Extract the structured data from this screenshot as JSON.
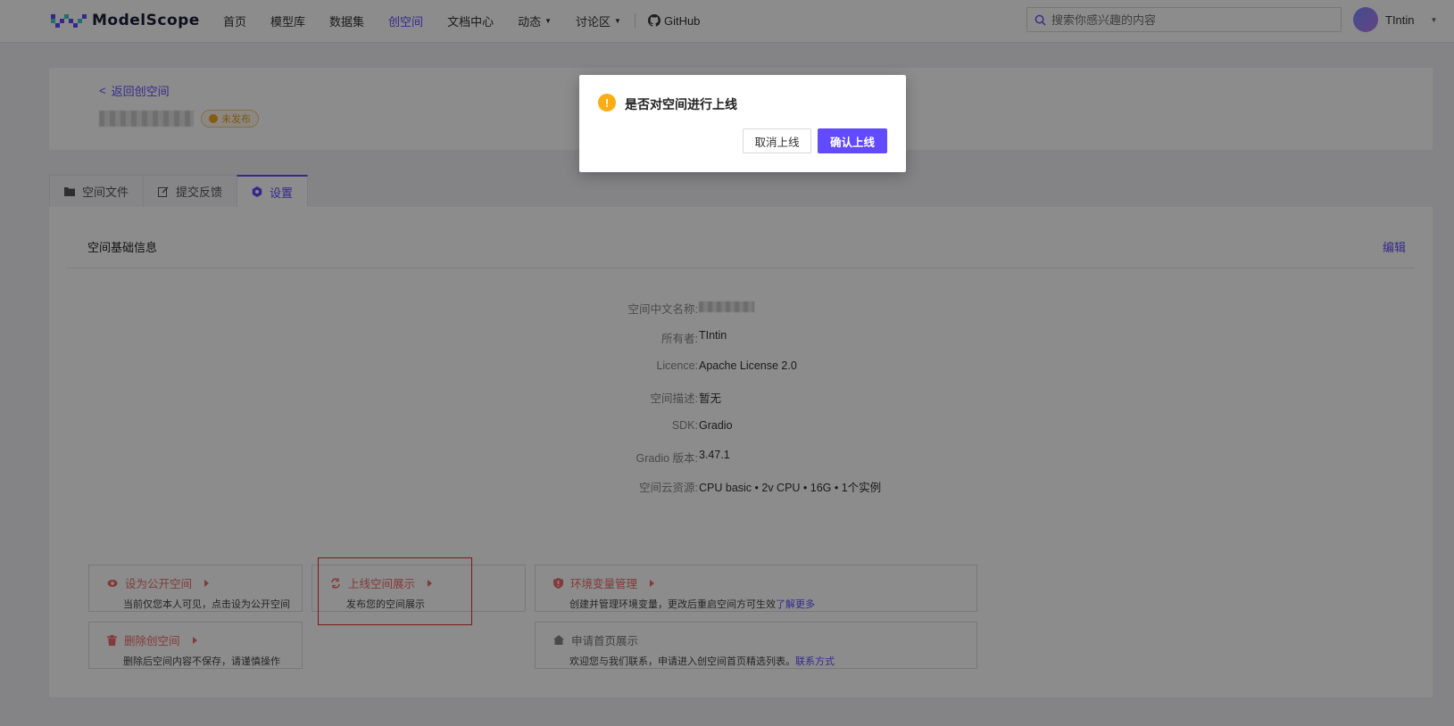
{
  "header": {
    "logo_text": "ModelScope",
    "nav": [
      {
        "label": "首页",
        "active": false
      },
      {
        "label": "模型库",
        "active": false
      },
      {
        "label": "数据集",
        "active": false
      },
      {
        "label": "创空间",
        "active": true
      },
      {
        "label": "文档中心",
        "active": false
      },
      {
        "label": "动态",
        "active": false
      },
      {
        "label": "讨论区",
        "active": false
      }
    ],
    "github_label": "GitHub",
    "search_placeholder": "搜索你感兴趣的内容",
    "username": "TIntin"
  },
  "top_card": {
    "back_label": "返回创空间",
    "status_badge": "未发布"
  },
  "tabs": [
    {
      "label": "空间文件",
      "icon": "folder-icon"
    },
    {
      "label": "提交反馈",
      "icon": "edit-icon"
    },
    {
      "label": "设置",
      "icon": "settings-icon",
      "active": true
    }
  ],
  "panel": {
    "title": "空间基础信息",
    "edit_label": "编辑",
    "info": [
      {
        "label": "空间中文名称:",
        "value": ""
      },
      {
        "label": "所有者:",
        "value": "TIntin"
      },
      {
        "label": "Licence:",
        "value": "Apache License 2.0"
      },
      {
        "label": "空间描述:",
        "value": "暂无"
      },
      {
        "label": "SDK:",
        "value": "Gradio"
      },
      {
        "label": "Gradio 版本:",
        "value": "3.47.1"
      },
      {
        "label": "空间云资源:",
        "value": "CPU basic • 2v CPU • 16G • 1个实例"
      }
    ],
    "actions": {
      "public": {
        "title": "设为公开空间",
        "desc": "当前仅您本人可见，点击设为公开空间"
      },
      "online": {
        "title": "上线空间展示",
        "desc": "发布您的空间展示"
      },
      "env": {
        "title": "环境变量管理",
        "desc": "创建并管理环境变量，更改后重启空间方可生效",
        "link": "了解更多"
      },
      "delete": {
        "title": "删除创空间",
        "desc": "删除后空间内容不保存，请谨慎操作"
      },
      "homepage": {
        "title": "申请首页展示",
        "desc": "欢迎您与我们联系，申请进入创空间首页精选列表。",
        "link": "联系方式"
      }
    }
  },
  "modal": {
    "title": "是否对空间进行上线",
    "icon": "!",
    "cancel_label": "取消上线",
    "confirm_label": "确认上线"
  },
  "colors": {
    "accent": "#624aff",
    "danger": "#ef6b6b",
    "warning": "#faad14"
  }
}
